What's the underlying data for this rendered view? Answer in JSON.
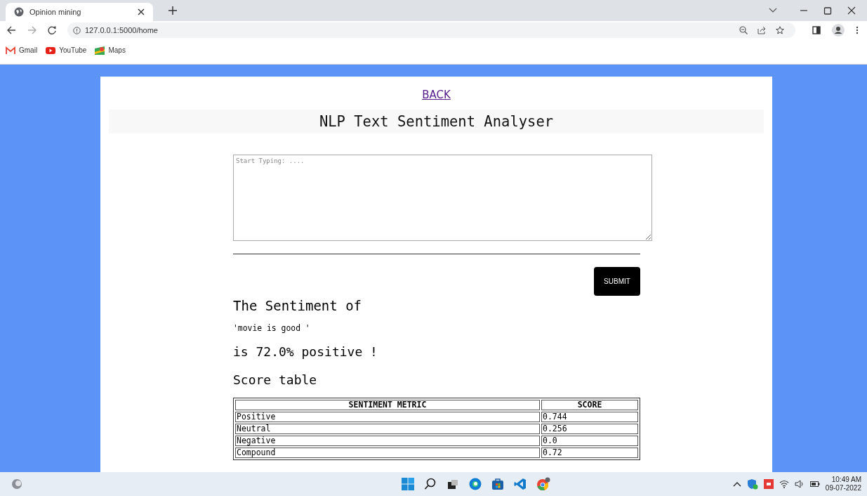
{
  "browser": {
    "tabs": [
      {
        "title": "Opinion mining",
        "selected": true
      }
    ],
    "address": "127.0.0.1:5000/home",
    "bookmarks": [
      {
        "label": "Gmail",
        "kind": "gmail"
      },
      {
        "label": "YouTube",
        "kind": "youtube"
      },
      {
        "label": "Maps",
        "kind": "maps"
      }
    ]
  },
  "page": {
    "back_link": "BACK",
    "heading": "NLP Text Sentiment Analyser",
    "input": {
      "placeholder": "Start Typing: ...."
    },
    "submit": "SUBMIT",
    "result_title": "The Sentiment of",
    "quoted_text": "'movie is good '",
    "verdict": "is 72.0% positive !",
    "table_title": "Score table",
    "table": {
      "columns": [
        "SENTIMENT METRIC",
        "SCORE"
      ],
      "rows": [
        [
          "Positive",
          "0.744"
        ],
        [
          "Neutral",
          "0.256"
        ],
        [
          "Negative",
          "0.0"
        ],
        [
          "Compound",
          "0.72"
        ]
      ]
    }
  },
  "taskbar": {
    "time": "10:49 AM",
    "date": "09-07-2022"
  }
}
